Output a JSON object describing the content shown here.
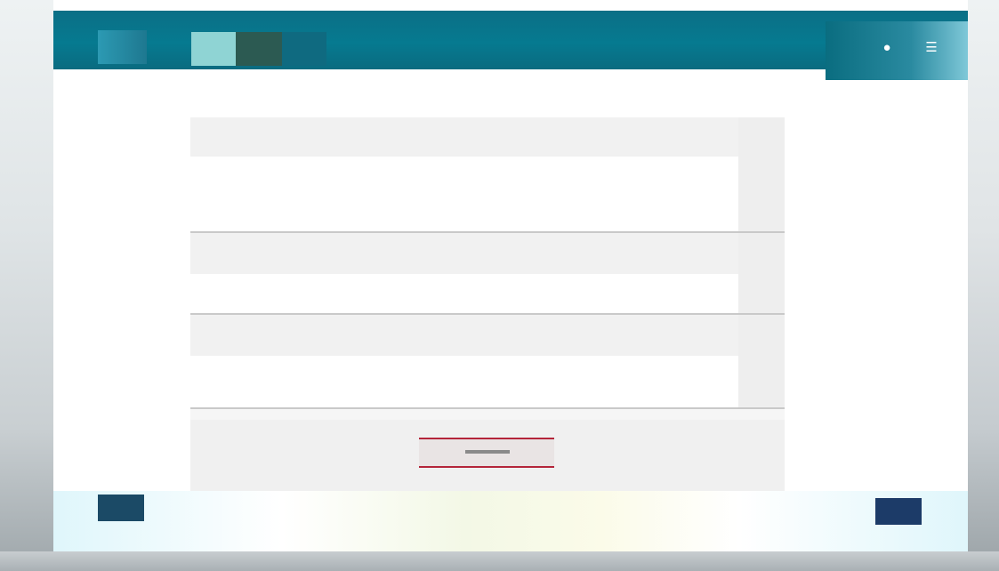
{
  "header": {
    "tabs": [
      {
        "label": "",
        "active": false
      },
      {
        "label": "",
        "active": true
      },
      {
        "label": "",
        "active": false
      },
      {
        "label": "",
        "active": false
      }
    ],
    "icons": [
      "user-icon",
      "menu-icon"
    ]
  },
  "breadcrumb": [
    "",
    "",
    ""
  ],
  "form": {
    "sections": [
      {
        "title": ""
      },
      {
        "title": ""
      },
      {
        "title": ""
      }
    ],
    "fields": [
      {
        "label": "",
        "value": "",
        "hint": ""
      },
      {
        "label": "",
        "value": ""
      },
      {
        "label": "",
        "value": ""
      },
      {
        "label": "",
        "value": ""
      },
      {
        "label": "",
        "value": ""
      }
    ],
    "cancel_label": ""
  },
  "colors": {
    "header": "#067a90",
    "accent_tab": "#8fd4d4",
    "danger": "#b4253a",
    "link": "#5563a8"
  }
}
